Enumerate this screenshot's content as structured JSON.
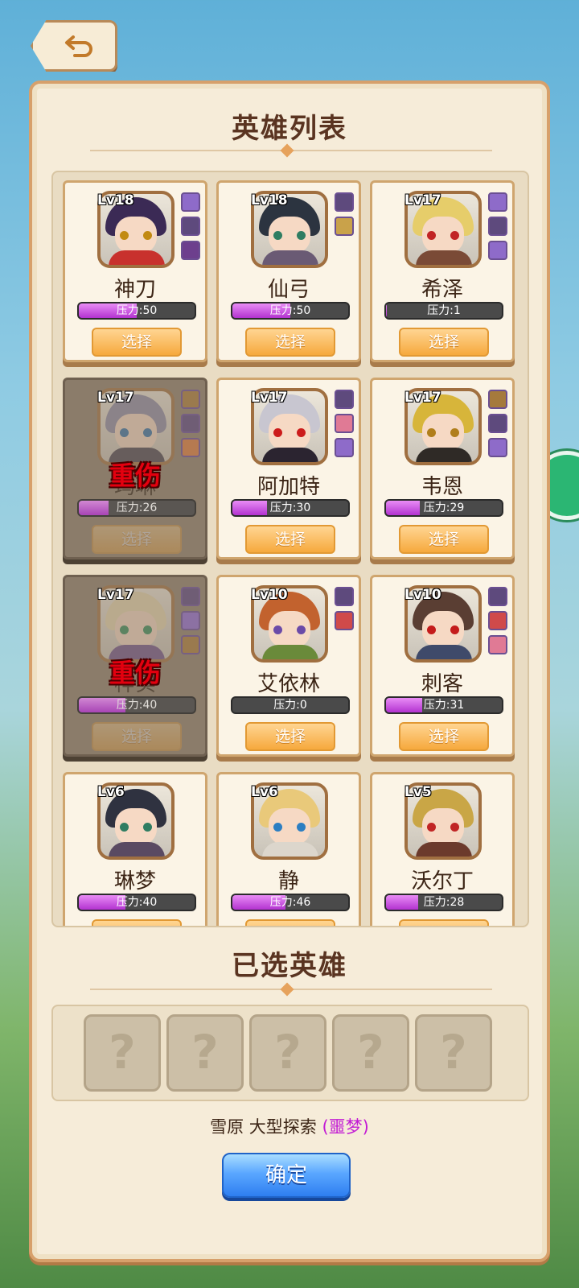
{
  "header": {
    "back_label": ""
  },
  "hero_list": {
    "title": "英雄列表",
    "select_label": "选择",
    "injured_label": "重伤",
    "heroes": [
      {
        "name": "神刀",
        "level": "Lv18",
        "pressure_text": "压力:50",
        "pressure": 50,
        "injured": false,
        "hair": "#3b2a55",
        "eye": "#c28a12",
        "body": "#c8312d",
        "items": [
          "#8e6bc9",
          "#5e4a7d",
          "#6d3f8d"
        ]
      },
      {
        "name": "仙弓",
        "level": "Lv18",
        "pressure_text": "压力:50",
        "pressure": 50,
        "injured": false,
        "hair": "#2c3440",
        "eye": "#2f7d62",
        "body": "#6a5a74",
        "items": [
          "#5e4a7d",
          "#c9a24a"
        ]
      },
      {
        "name": "希泽",
        "level": "Lv17",
        "pressure_text": "压力:1",
        "pressure": 1,
        "injured": false,
        "hair": "#e6cd6a",
        "eye": "#c12525",
        "body": "#7a4a36",
        "items": [
          "#8e6bc9",
          "#5e4a7d",
          "#8e6bc9"
        ]
      },
      {
        "name": "玛琳",
        "level": "Lv17",
        "pressure_text": "压力:26",
        "pressure": 26,
        "injured": true,
        "hair": "#8c8aa8",
        "eye": "#2e6fa8",
        "body": "#454050",
        "items": [
          "#a57a3c",
          "#5e4a7d",
          "#d37a3f"
        ]
      },
      {
        "name": "阿加特",
        "level": "Lv17",
        "pressure_text": "压力:30",
        "pressure": 30,
        "injured": false,
        "hair": "#c8c6d0",
        "eye": "#cc1b1b",
        "body": "#2b2430",
        "items": [
          "#5e4a7d",
          "#e07a95",
          "#8e6bc9"
        ]
      },
      {
        "name": "韦恩",
        "level": "Lv17",
        "pressure_text": "压力:29",
        "pressure": 29,
        "injured": false,
        "hair": "#d7b53a",
        "eye": "#b07e1b",
        "body": "#2f2a26",
        "items": [
          "#a57a3c",
          "#5e4a7d",
          "#8e6bc9"
        ]
      },
      {
        "name": "梓实",
        "level": "Lv17",
        "pressure_text": "压力:40",
        "pressure": 40,
        "injured": true,
        "hair": "#e8d9b0",
        "eye": "#2e8a5a",
        "body": "#6d4f8a",
        "items": [
          "#5e4a7d",
          "#8e6bc9",
          "#a57a3c"
        ]
      },
      {
        "name": "艾依林",
        "level": "Lv10",
        "pressure_text": "压力:0",
        "pressure": 0,
        "injured": false,
        "hair": "#c2622e",
        "eye": "#6b4aa8",
        "body": "#6a8a3a",
        "items": [
          "#5e4a7d",
          "#d04a4a"
        ]
      },
      {
        "name": "刺客",
        "level": "Lv10",
        "pressure_text": "压力:31",
        "pressure": 31,
        "injured": false,
        "hair": "#5a3e33",
        "eye": "#c41b1b",
        "body": "#3f4a6a",
        "items": [
          "#5e4a7d",
          "#d04a4a",
          "#e07a95"
        ]
      },
      {
        "name": "琳梦",
        "level": "Lv6",
        "pressure_text": "压力:40",
        "pressure": 40,
        "injured": false,
        "hair": "#2f3240",
        "eye": "#2f7d62",
        "body": "#5a4a62",
        "items": []
      },
      {
        "name": "静",
        "level": "Lv6",
        "pressure_text": "压力:46",
        "pressure": 46,
        "injured": false,
        "hair": "#e9c97a",
        "eye": "#2b7ec2",
        "body": "#dcd6cc",
        "items": []
      },
      {
        "name": "沃尔丁",
        "level": "Lv5",
        "pressure_text": "压力:28",
        "pressure": 28,
        "injured": false,
        "hair": "#c9a646",
        "eye": "#c12525",
        "body": "#6b3a2c",
        "items": []
      }
    ]
  },
  "selected": {
    "title": "已选英雄",
    "slots": [
      "?",
      "?",
      "?",
      "?",
      "?"
    ]
  },
  "mission": {
    "location": "雪原 大型探索",
    "difficulty": "(噩梦)"
  },
  "confirm_label": "确定"
}
